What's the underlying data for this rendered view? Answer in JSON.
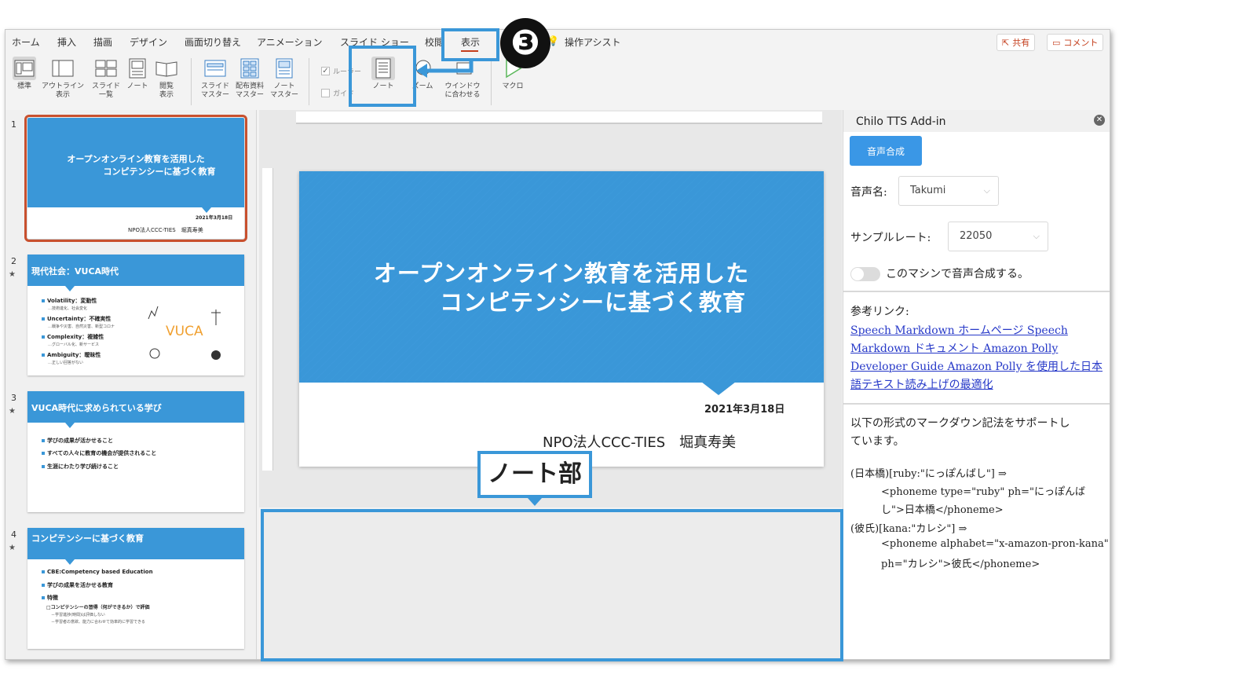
{
  "tabs": [
    "ホーム",
    "挿入",
    "描画",
    "デザイン",
    "画面切り替え",
    "アニメーション",
    "スライド ショー",
    "校閲",
    "表示",
    "操作アシスト"
  ],
  "share_label": "共有",
  "comment_label": "コメント",
  "ribbon": {
    "normal": "標準",
    "outline": [
      "アウトライン",
      "表示"
    ],
    "sorter": [
      "スライド",
      "一覧"
    ],
    "notes_page": "ノート",
    "reading": [
      "閲覧",
      "表示"
    ],
    "slide_master": [
      "スライド",
      "マスター"
    ],
    "handout_master": [
      "配布資料",
      "マスター"
    ],
    "notes_master": [
      "ノート",
      "マスター"
    ],
    "ruler": "ルーラー",
    "guides": "ガイド",
    "notes": "ノート",
    "zoom": "ズーム",
    "fit_window": [
      "ウインドウ",
      "に合わせる"
    ],
    "macro": "マクロ"
  },
  "thumbnails": [
    {
      "num": "1",
      "title1": "オープンオンライン教育を活用した",
      "title2": "コンピテンシーに基づく教育",
      "date": "2021年3月18日",
      "org": "NPO法人CCC-TIES　堀真寿美"
    },
    {
      "num": "2",
      "title": "現代社会：VUCA時代",
      "bullets": [
        "Volatility：変動性",
        "Uncertainty：不確実性",
        "Complexity：複雑性",
        "Ambiguity：曖昧性"
      ],
      "subs": [
        "…技術進化、社会変化",
        "…戦争や災害、自然災害、新型コロナ",
        "…グローバル化、新サービス",
        "…正しい回答がない"
      ],
      "logo": "VUCA"
    },
    {
      "num": "3",
      "title": "VUCA時代に求められている学び",
      "bullets": [
        "学びの成果が活かせること",
        "すべての人々に教育の機会が提供されること",
        "生涯にわたり学び続けること"
      ]
    },
    {
      "num": "4",
      "title": "コンピテンシーに基づく教育",
      "bullets": [
        "CBE:Competency based Education",
        "学びの成果を活かせる教育",
        "特徴"
      ],
      "sub1": "□コンピテンシーの習得（何ができるか）で評価",
      "subs": [
        "－学習進捗(時間)は評価しない",
        "－学習者の意欲、能力に合わせて効率的に学習できる"
      ]
    }
  ],
  "slide": {
    "title1": "オープンオンライン教育を活用した",
    "title2": "コンピテンシーに基づく教育",
    "date": "2021年3月18日",
    "org": "NPO法人CCC-TIES　堀真寿美"
  },
  "pane": {
    "title": "Chilo TTS Add-in",
    "synth_button": "音声合成",
    "voice_label": "音声名:",
    "voice_value": "Takumi",
    "rate_label": "サンプルレート:",
    "rate_value": "22050",
    "toggle_label": "このマシンで音声合成する。",
    "links_label": "参考リンク:",
    "links": [
      "Speech Markdown ホームページ",
      "Speech Markdown ドキュメント",
      "Amazon Polly Developer Guide",
      "Amazon Polly を使用した日本語テキスト読み上げの最適化"
    ],
    "links_lines": [
      "Speech Markdown ホームページ Speech",
      "Markdown ドキュメント Amazon Polly",
      "Developer Guide Amazon Polly を使用した日本",
      "語テキスト読み上げの最適化"
    ],
    "desc_lines": [
      "以下の形式のマークダウン記法をサポートし",
      "ています。"
    ],
    "ex1": "(日本橋)[ruby:\"にっぽんばし\"] ⇒",
    "ex1_out": [
      "<phoneme type=\"ruby\" ph=\"にっぽんば",
      "し\">日本橋</phoneme>"
    ],
    "ex2": "(彼氏)[kana:\"カレシ\"] ⇒",
    "ex2_out": [
      "<phoneme alphabet=\"x-amazon-pron-kana\"",
      "ph=\"カレシ\">彼氏</phoneme>"
    ]
  },
  "annotations": {
    "notes_label": "ノート部",
    "step_number": "❸"
  },
  "colors": {
    "accent": "#3a97d8",
    "tab_underline": "#c43e1c",
    "link": "#2638c8"
  }
}
